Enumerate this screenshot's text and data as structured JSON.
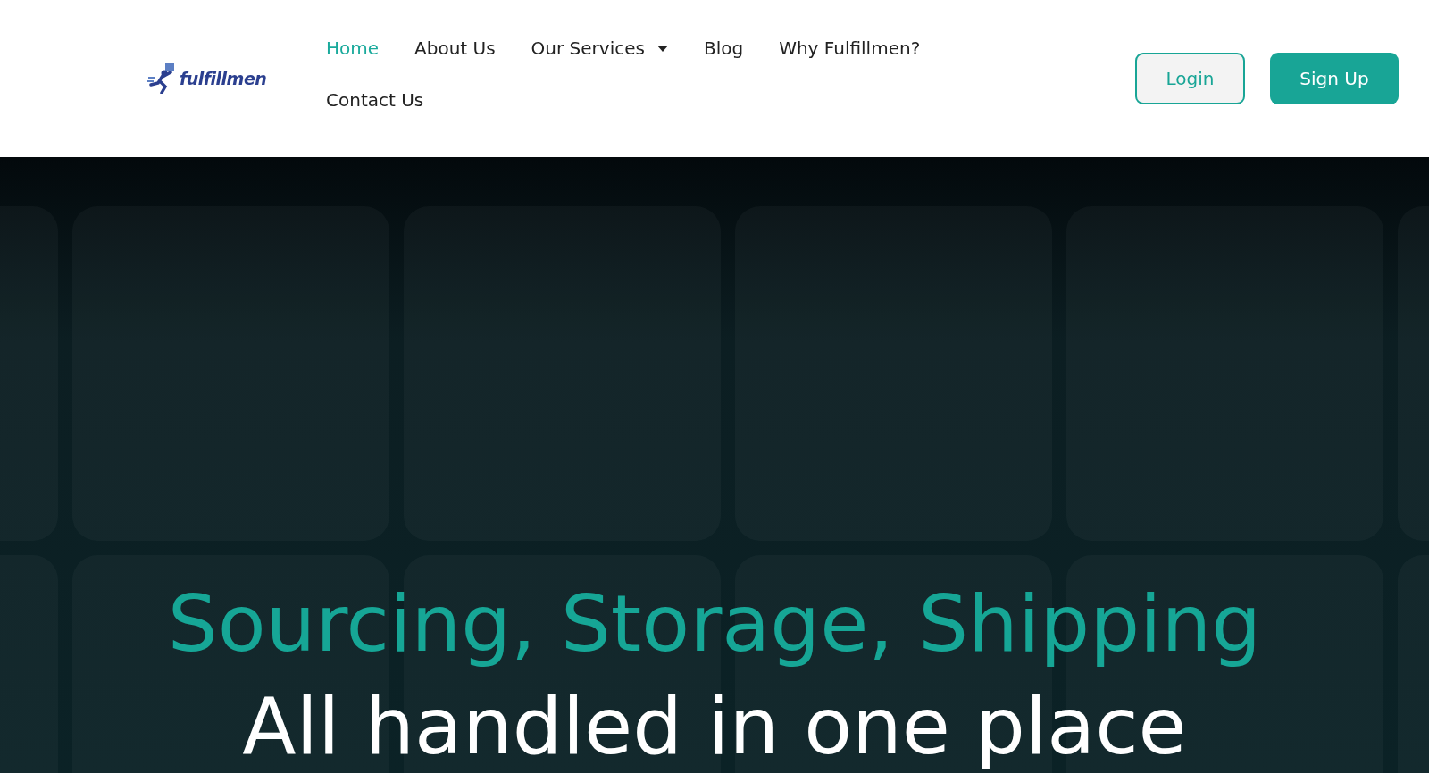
{
  "header": {
    "logo": {
      "text": "fulfillmen"
    },
    "nav": [
      {
        "label": "Home",
        "selected": true,
        "dropdown": false
      },
      {
        "label": "About Us",
        "selected": false,
        "dropdown": false
      },
      {
        "label": "Our Services",
        "selected": false,
        "dropdown": true
      },
      {
        "label": "Blog",
        "selected": false,
        "dropdown": false
      },
      {
        "label": "Why Fulfillmen?",
        "selected": false,
        "dropdown": false
      },
      {
        "label": "Contact Us",
        "selected": false,
        "dropdown": false
      }
    ],
    "buttons": [
      {
        "label": "Login",
        "kind": "outline"
      },
      {
        "label": "Sign Up",
        "kind": "solid"
      }
    ]
  },
  "hero": {
    "headline": "Sourcing, Storage, Shipping",
    "subheadline": "All handled in one place"
  }
}
